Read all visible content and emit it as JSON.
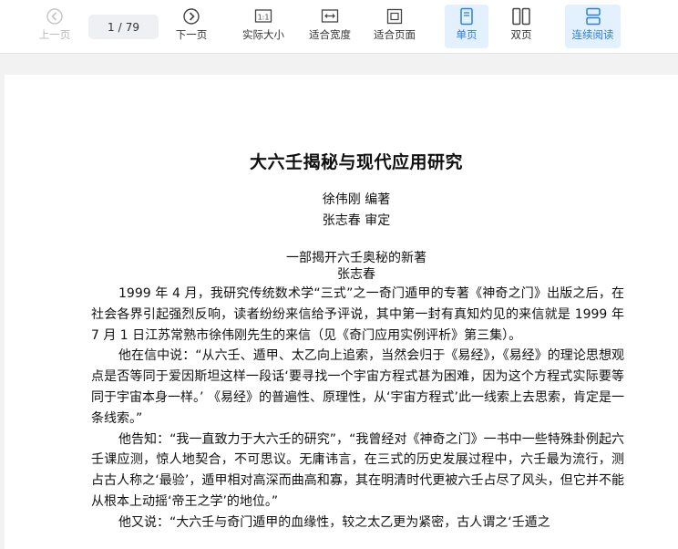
{
  "toolbar": {
    "prev_label": "上一页",
    "page_current": "1",
    "page_sep": "/",
    "page_total": "79",
    "next_label": "下一页",
    "actual_size_label": "实际大小",
    "fit_width_label": "适合宽度",
    "fit_page_label": "适合页面",
    "single_label": "单页",
    "double_label": "双页",
    "continuous_label": "连续阅读",
    "accent_color": "#2a7fe0"
  },
  "document": {
    "title": "大六壬揭秘与现代应用研究",
    "author": "徐伟刚 编著",
    "reviewer": "张志春 审定",
    "preface_title": "一部揭开六壬奥秘的新著",
    "preface_author": "张志春",
    "paragraphs": [
      "1999 年 4 月，我研究传统数术学“三式”之一奇门遁甲的专著《神奇之门》出版之后，在社会各界引起强烈反响，读者纷纷来信给予评说，其中第一封有真知灼见的来信就是 1999 年 7 月 1 日江苏常熟市徐伟刚先生的来信（见《奇门应用实例评析》第三集）。",
      "他在信中说：“从六壬、遁甲、太乙向上追索，当然会归于《易经》，《易经》的理论思想观点是否等同于爱因斯坦这样一段话‘要寻找一个宇宙方程式甚为困难，因为这个方程式实际要等同于宇宙本身一样。’ 《易经》的普遍性、原理性，从‘宇宙方程式’此一线索上去思索，肯定是一条线索。”",
      "他告知：“我一直致力于大六壬的研究”，“我曾经对《神奇之门》一书中一些特殊卦例起六壬课应测，惊人地契合，不可思议。无庸讳言，在三式的历史发展过程中，六壬最为流行，测占古人称之‘最验’，遁甲相对高深而曲高和寡，其在明清时代更被六壬占尽了风头，但它并不能从根本上动摇‘帝王之学’的地位。”",
      "他又说：“大六壬与奇门遁甲的血缘性，较之太乙更为紧密，古人谓之‘壬遁之"
    ]
  }
}
